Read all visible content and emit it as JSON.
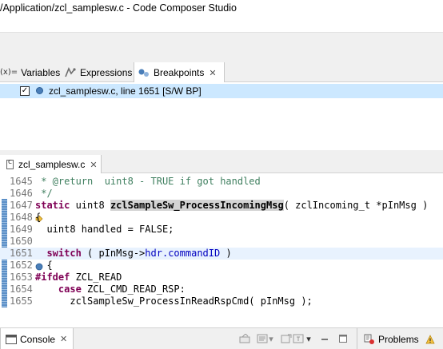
{
  "window": {
    "title": "/Application/zcl_samplesw.c - Code Composer Studio"
  },
  "views": {
    "tabs": [
      {
        "label": "Variables",
        "prefix": "(x)="
      },
      {
        "label": "Expressions"
      },
      {
        "label": "Breakpoints"
      }
    ],
    "breakpoints": [
      {
        "label": "zcl_samplesw.c, line 1651 [S/W BP]",
        "checked": true
      }
    ]
  },
  "editor": {
    "tab_label": "zcl_samplesw.c",
    "lines": [
      {
        "num": "1645",
        "text": " * @return  uint8 - TRUE if got handled"
      },
      {
        "num": "1646",
        "text": " */"
      },
      {
        "num": "1647",
        "kw": "static",
        "pre": " uint8 ",
        "fn": "zclSampleSw_ProcessIncomingMsg",
        "post": "( zclIncoming_t *pInMsg )"
      },
      {
        "num": "1648",
        "text": "{"
      },
      {
        "num": "1649",
        "text": "  uint8 handled = FALSE;"
      },
      {
        "num": "1650",
        "text": ""
      },
      {
        "num": "1651",
        "indent": "  ",
        "kw": "switch",
        "pre": " ( pInMsg->",
        "field": "hdr.commandID",
        "post": " )"
      },
      {
        "num": "1652",
        "text": "  {"
      },
      {
        "num": "1653",
        "kw": "#ifdef",
        "post": " ZCL_READ"
      },
      {
        "num": "1654",
        "indent": "    ",
        "kw": "case",
        "post": " ZCL_CMD_READ_RSP:"
      },
      {
        "num": "1655",
        "text": "      zclSampleSw_ProcessInReadRspCmd( pInMsg );"
      }
    ]
  },
  "bottom": {
    "console_label": "Console",
    "problems_label": "Problems"
  },
  "icons": {
    "close": "close-icon",
    "checkmark": "✓"
  }
}
